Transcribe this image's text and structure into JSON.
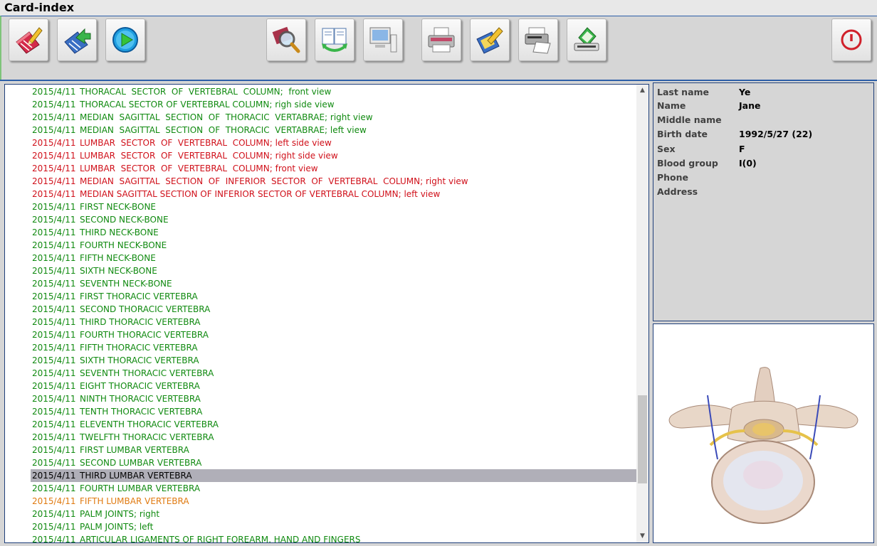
{
  "window": {
    "title": "Card-index"
  },
  "toolbar": {
    "buttons": [
      {
        "name": "edit-card-button",
        "icon": "pencil-card-icon"
      },
      {
        "name": "import-button",
        "icon": "card-arrow-icon"
      },
      {
        "name": "play-button",
        "icon": "play-icon"
      },
      {
        "name": "search-button",
        "icon": "magnifier-icon"
      },
      {
        "name": "copy-compare-button",
        "icon": "documents-cycle-icon"
      },
      {
        "name": "computer-button",
        "icon": "computer-icon"
      },
      {
        "name": "print-button",
        "icon": "printer-icon"
      },
      {
        "name": "edit-image-button",
        "icon": "image-pencil-icon"
      },
      {
        "name": "fax-print-button",
        "icon": "fax-icon"
      },
      {
        "name": "scan-button",
        "icon": "scanner-icon"
      },
      {
        "name": "exit-button",
        "icon": "power-icon"
      }
    ]
  },
  "colors": {
    "green": "#108a10",
    "red": "#d0101a",
    "orange": "#e07a10",
    "selected_bg": "#b0afb8"
  },
  "list": {
    "items": [
      {
        "date": "2015/4/11",
        "text": "THORACAL  SECTOR  OF  VERTEBRAL  COLUMN;  front view",
        "status": "green"
      },
      {
        "date": "2015/4/11",
        "text": "THORACAL SECTOR OF VERTEBRAL COLUMN; righ side view",
        "status": "green"
      },
      {
        "date": "2015/4/11",
        "text": "MEDIAN  SAGITTAL  SECTION  OF  THORACIC  VERTABRAE; right view",
        "status": "green"
      },
      {
        "date": "2015/4/11",
        "text": "MEDIAN  SAGITTAL  SECTION  OF  THORACIC  VERTABRAE; left view",
        "status": "green"
      },
      {
        "date": "2015/4/11",
        "text": "LUMBAR  SECTOR  OF  VERTEBRAL  COLUMN; left side view",
        "status": "red"
      },
      {
        "date": "2015/4/11",
        "text": "LUMBAR  SECTOR  OF  VERTEBRAL  COLUMN; right side view",
        "status": "red"
      },
      {
        "date": "2015/4/11",
        "text": "LUMBAR  SECTOR  OF  VERTEBRAL  COLUMN; front view",
        "status": "red"
      },
      {
        "date": "2015/4/11",
        "text": "MEDIAN  SAGITTAL  SECTION  OF  INFERIOR  SECTOR  OF  VERTEBRAL  COLUMN; right view",
        "status": "red"
      },
      {
        "date": "2015/4/11",
        "text": "MEDIAN SAGITTAL SECTION OF INFERIOR SECTOR OF VERTEBRAL COLUMN; left view",
        "status": "red"
      },
      {
        "date": "2015/4/11",
        "text": "FIRST NECK-BONE",
        "status": "green"
      },
      {
        "date": "2015/4/11",
        "text": "SECOND NECK-BONE",
        "status": "green"
      },
      {
        "date": "2015/4/11",
        "text": "THIRD NECK-BONE",
        "status": "green"
      },
      {
        "date": "2015/4/11",
        "text": "FOURTH NECK-BONE",
        "status": "green"
      },
      {
        "date": "2015/4/11",
        "text": "FIFTH NECK-BONE",
        "status": "green"
      },
      {
        "date": "2015/4/11",
        "text": "SIXTH NECK-BONE",
        "status": "green"
      },
      {
        "date": "2015/4/11",
        "text": "SEVENTH NECK-BONE",
        "status": "green"
      },
      {
        "date": "2015/4/11",
        "text": "FIRST THORACIC VERTEBRA",
        "status": "green"
      },
      {
        "date": "2015/4/11",
        "text": "SECOND THORACIC VERTEBRA",
        "status": "green"
      },
      {
        "date": "2015/4/11",
        "text": "THIRD THORACIC VERTEBRA",
        "status": "green"
      },
      {
        "date": "2015/4/11",
        "text": "FOURTH THORACIC VERTEBRA",
        "status": "green"
      },
      {
        "date": "2015/4/11",
        "text": "FIFTH THORACIC VERTEBRA",
        "status": "green"
      },
      {
        "date": "2015/4/11",
        "text": "SIXTH THORACIC VERTEBRA",
        "status": "green"
      },
      {
        "date": "2015/4/11",
        "text": "SEVENTH THORACIC VERTEBRA",
        "status": "green"
      },
      {
        "date": "2015/4/11",
        "text": "EIGHT THORACIC VERTEBRA",
        "status": "green"
      },
      {
        "date": "2015/4/11",
        "text": "NINTH THORACIC VERTEBRA",
        "status": "green"
      },
      {
        "date": "2015/4/11",
        "text": "TENTH THORACIC VERTEBRA",
        "status": "green"
      },
      {
        "date": "2015/4/11",
        "text": "ELEVENTH THORACIC VERTEBRA",
        "status": "green"
      },
      {
        "date": "2015/4/11",
        "text": "TWELFTH THORACIC VERTEBRA",
        "status": "green"
      },
      {
        "date": "2015/4/11",
        "text": "FIRST LUMBAR VERTEBRA",
        "status": "green"
      },
      {
        "date": "2015/4/11",
        "text": "SECOND LUMBAR VERTEBRA",
        "status": "green"
      },
      {
        "date": "2015/4/11",
        "text": "THIRD LUMBAR VERTEBRA",
        "status": "selected"
      },
      {
        "date": "2015/4/11",
        "text": "FOURTH LUMBAR VERTEBRA",
        "status": "green"
      },
      {
        "date": "2015/4/11",
        "text": "FIFTH LUMBAR VERTEBRA",
        "status": "orange"
      },
      {
        "date": "2015/4/11",
        "text": "PALM JOINTS; right",
        "status": "green"
      },
      {
        "date": "2015/4/11",
        "text": "PALM JOINTS; left",
        "status": "green"
      },
      {
        "date": "2015/4/11",
        "text": "ARTICULAR LIGAMENTS OF RIGHT FOREARM, HAND AND FINGERS",
        "status": "green"
      }
    ]
  },
  "patient": {
    "fields": [
      {
        "label": "Last name",
        "value": "Ye"
      },
      {
        "label": "Name",
        "value": "Jane"
      },
      {
        "label": "Middle name",
        "value": ""
      },
      {
        "label": "Birth date",
        "value": "1992/5/27 (22)"
      },
      {
        "label": "Sex",
        "value": "F"
      },
      {
        "label": "Blood group",
        "value": "I(0)"
      },
      {
        "label": "Phone",
        "value": ""
      },
      {
        "label": "Address",
        "value": ""
      }
    ]
  },
  "image": {
    "icon": "vertebra-image"
  }
}
